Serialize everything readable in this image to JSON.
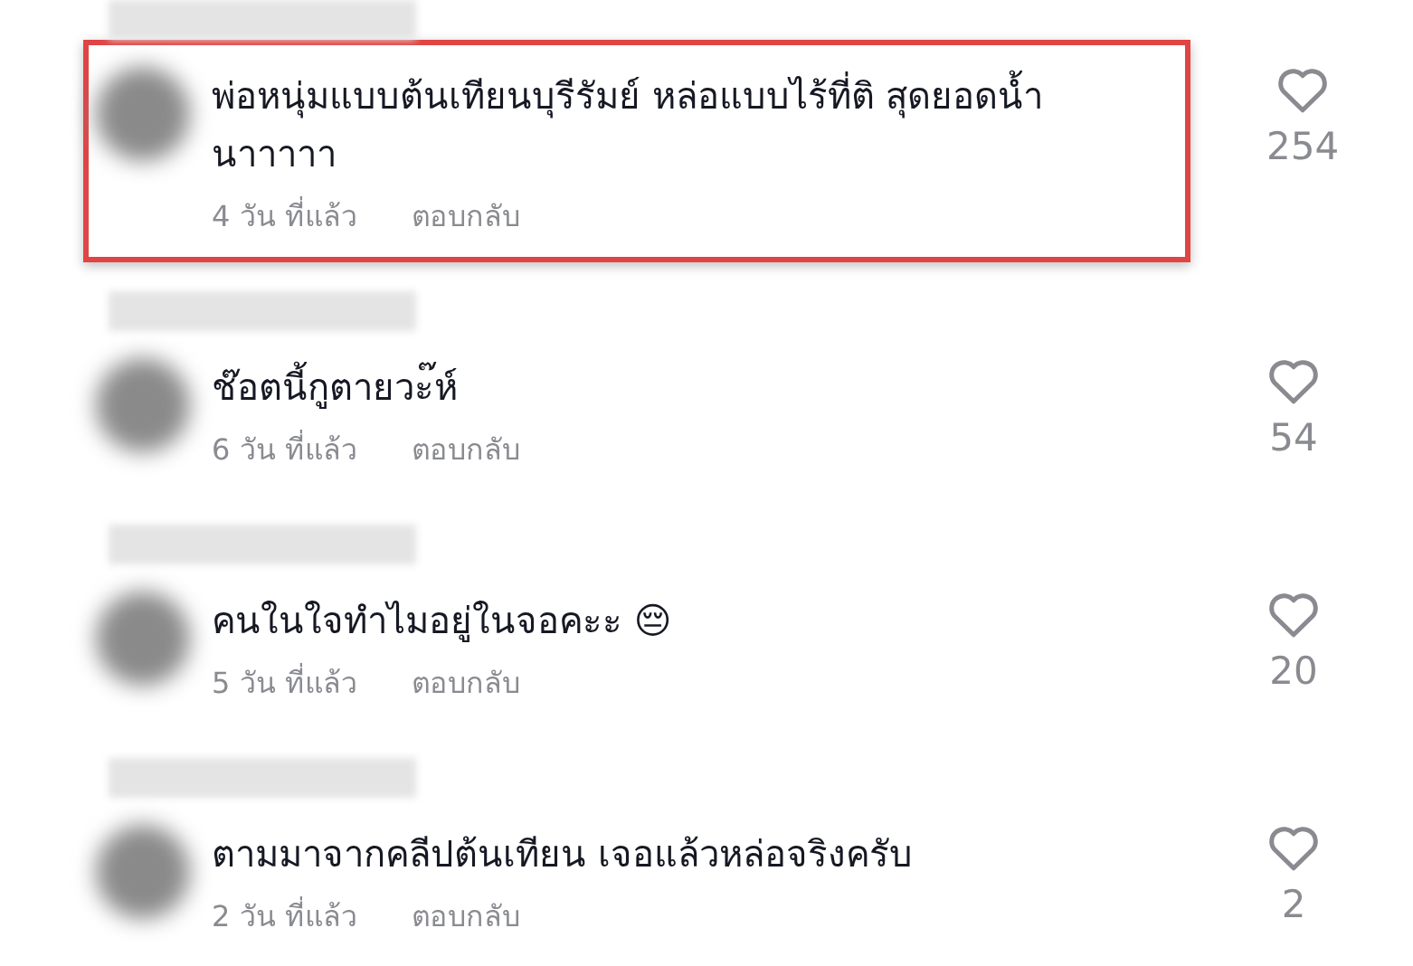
{
  "comments": [
    {
      "text": "พ่อหนุ่มแบบต้นเทียนบุรีรัมย์ หล่อแบบไร้ที่ติ สุดยอดน้ำนาาาาา",
      "time": "4 วัน ที่แล้ว",
      "reply": "ตอบกลับ",
      "likes": "254",
      "highlighted": true
    },
    {
      "text": "ช๊อตนี้กูตายวะ๊ห์",
      "time": "6 วัน ที่แล้ว",
      "reply": "ตอบกลับ",
      "likes": "54",
      "highlighted": false
    },
    {
      "text": "คนในใจทำไมอยู่ในจอคะะ 😔",
      "time": "5 วัน ที่แล้ว",
      "reply": "ตอบกลับ",
      "likes": "20",
      "highlighted": false
    },
    {
      "text": "ตามมาจากคลีปต้นเทียน เจอแล้วหล่อจริงครับ",
      "time": "2 วัน ที่แล้ว",
      "reply": "ตอบกลับ",
      "likes": "2",
      "highlighted": false
    }
  ]
}
